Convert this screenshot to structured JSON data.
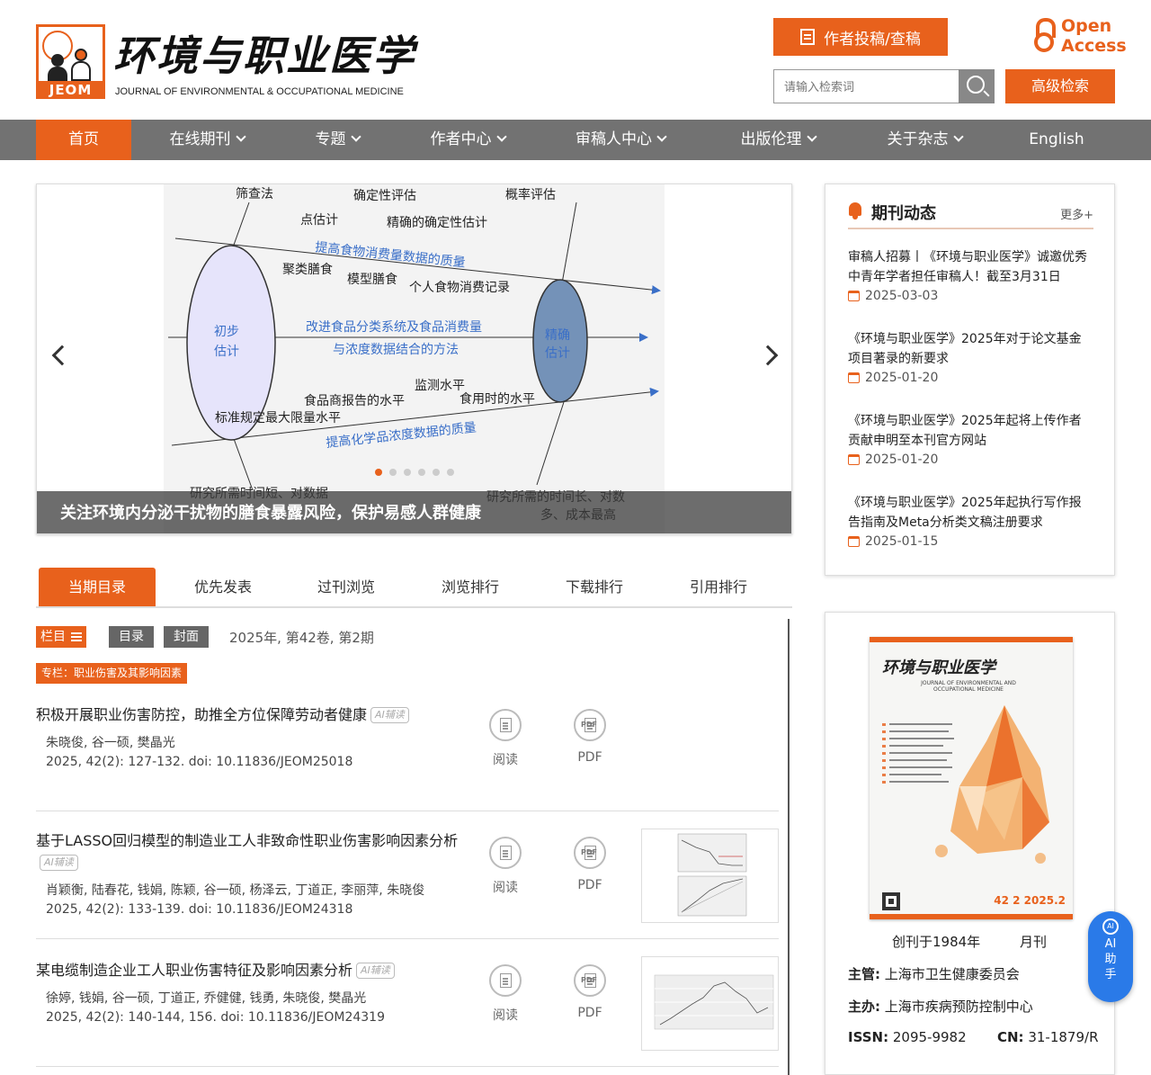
{
  "header": {
    "logo_text": "JEOM",
    "journal_name_cn": "环境与职业医学",
    "journal_name_en": "JOURNAL OF ENVIRONMENTAL & OCCUPATIONAL MEDICINE",
    "submit_label": "作者投稿/查稿",
    "open_access": "Open Access",
    "search_placeholder": "请输入检索词",
    "advanced_search_label": "高级检索"
  },
  "nav": {
    "items": [
      {
        "label": "首页",
        "active": true
      },
      {
        "label": "在线期刊"
      },
      {
        "label": "专题"
      },
      {
        "label": "作者中心"
      },
      {
        "label": "审稿人中心"
      },
      {
        "label": "出版伦理"
      },
      {
        "label": "关于杂志"
      },
      {
        "label": "English"
      }
    ]
  },
  "carousel": {
    "caption": "关注环境内分泌干扰物的膳食暴露风险，保护易感人群健康",
    "slide_count": 6,
    "active_index": 0,
    "diagram": {
      "labels": {
        "screening": "筛查法",
        "deterministic": "确定性评估",
        "probabilistic": "概率评估",
        "point_est": "点估计",
        "precise_det": "精确的确定性估计",
        "improve_food": "提高食物消费量数据的质量",
        "cluster": "聚类膳食",
        "model": "模型膳食",
        "individual": "个人食物消费记录",
        "preliminary": "初步估计",
        "precise": "精确估计",
        "improve_class": "改进食品分类系统及食品消费量",
        "combine": "与浓度数据结合的方法",
        "monitor": "监测水平",
        "manufacturer": "食品商报告的水平",
        "eating": "食用时的水平",
        "standard": "标准规定最大限量水平",
        "improve_chem": "提高化学品浓度数据的质量",
        "short_time": "研究所需时间短、对数据",
        "long_time": "研究所需的时间长、对数",
        "cost_high": "多、成本最高"
      }
    }
  },
  "tabs": [
    "当期目录",
    "优先发表",
    "过刊浏览",
    "浏览排行",
    "下载排行",
    "引用排行"
  ],
  "toc": {
    "column_btn": "栏目",
    "toc_btn": "目录",
    "cover_btn": "封面",
    "issue": "2025年, 第42卷, 第2期",
    "section_tag": "专栏：职业伤害及其影响因素",
    "ai_tag": "AI辅读",
    "read_label": "阅读",
    "pdf_label": "PDF",
    "articles": [
      {
        "title": "积极开展职业伤害防控，助推全方位保障劳动者健康",
        "authors": "朱晓俊, 谷一硕, 樊晶光",
        "citation": "2025, 42(2): 127-132. doi: 10.11836/JEOM25018"
      },
      {
        "title": "基于LASSO回归模型的制造业工人非致命性职业伤害影响因素分析",
        "authors": "肖颖衡, 陆春花, 钱娟, 陈颖, 谷一硕, 杨泽云, 丁道正, 李丽萍, 朱晓俊",
        "citation": "2025, 42(2): 133-139. doi: 10.11836/JEOM24318"
      },
      {
        "title": "某电缆制造企业工人职业伤害特征及影响因素分析",
        "authors": "徐婷, 钱娟, 谷一硕, 丁道正, 乔健健, 钱勇, 朱晓俊, 樊晶光",
        "citation": "2025, 42(2): 140-144, 156. doi: 10.11836/JEOM24319"
      }
    ]
  },
  "news": {
    "title": "期刊动态",
    "more": "更多+",
    "items": [
      {
        "text": "审稿人招募丨《环境与职业医学》诚邀优秀中青年学者担任审稿人！截至3月31日",
        "date": "2025-03-03"
      },
      {
        "text": "《环境与职业医学》2025年对于论文基金项目著录的新要求",
        "date": "2025-01-20"
      },
      {
        "text": "《环境与职业医学》2025年起将上传作者贡献申明至本刊官方网站",
        "date": "2025-01-20"
      },
      {
        "text": "《环境与职业医学》2025年起执行写作报告指南及Meta分析类文稿注册要求",
        "date": "2025-01-15"
      }
    ]
  },
  "cover": {
    "cover_title": "环境与职业医学",
    "cover_en": "JOURNAL OF ENVIRONMENTAL AND OCCUPATIONAL MEDICINE",
    "cover_issue": "42 2 2025.2",
    "founded": "创刊于1984年",
    "frequency": "月刊",
    "sponsor_label": "主管:",
    "sponsor": "上海市卫生健康委员会",
    "organizer_label": "主办:",
    "organizer": "上海市疾病预防控制中心",
    "issn_label": "ISSN:",
    "issn": "2095-9982",
    "cn_label": "CN:",
    "cn": "31-1879/R"
  },
  "ai_assistant": {
    "icon": "AI",
    "label": [
      "AI",
      "助",
      "手"
    ]
  },
  "colors": {
    "accent": "#e8611c",
    "nav_bg": "#727272",
    "ai_blue": "#2a7ae8"
  }
}
